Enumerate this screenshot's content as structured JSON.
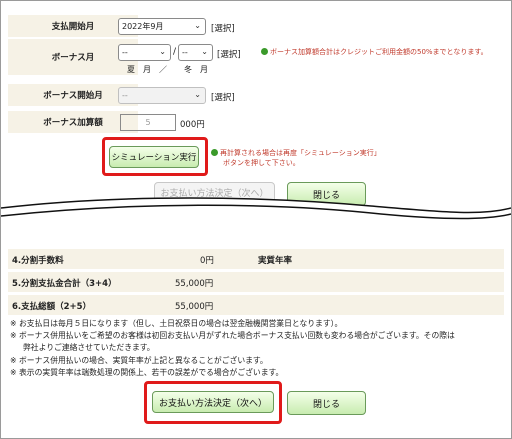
{
  "form": {
    "pay_start": {
      "label": "支払開始月",
      "value": "2022年9月",
      "action": "[選択]"
    },
    "bonus_month": {
      "label": "ボーナス月",
      "summer": "--",
      "winter": "--",
      "action": "[選択]",
      "summer_label": "夏　月",
      "slash": "／",
      "winter_label": "冬　月",
      "note": "ボーナス加算額合計はクレジットご利用金額の50%までとなります。"
    },
    "bonus_start": {
      "label": "ボーナス開始月",
      "value": "--",
      "action": "[選択]"
    },
    "bonus_amount": {
      "label": "ボーナス加算額",
      "value": "5",
      "unit": "000円"
    }
  },
  "simulate_button": "シミュレーション実行",
  "recalc_note": {
    "line1": "再計算される場合は再度「シミュレーション実行」",
    "line2": "ボタンを押して下さい。"
  },
  "top_buttons": {
    "decide": "お支払い方法決定（次へ）",
    "close": "閉じる"
  },
  "results": [
    {
      "label": "4.分割手数料",
      "value": "0円",
      "extra_label": "実質年率",
      "extra_value": ""
    },
    {
      "label": "5.分割支払金合計（3+4）",
      "value": "55,000円"
    },
    {
      "label": "6.支払総額（2+5）",
      "value": "55,000円"
    }
  ],
  "notes": [
    "※ お支払日は毎月５日になります（但し、土日祝祭日の場合は翌金融機関営業日となります）。",
    "※ ボーナス併用払いをご希望のお客様は初回お支払い月がずれた場合ボーナス支払い回数も変わる場合がございます。その際は",
    "弊社よりご連絡させていただきます。",
    "※ ボーナス併用払いの場合、実質年率が上記と異なることがございます。",
    "※ 表示の実質年率は端数処理の関係上、若干の誤差がでる場合がございます。"
  ],
  "bottom_buttons": {
    "decide": "お支払い方法決定（次へ）",
    "close": "閉じる"
  },
  "colors": {
    "label_bg": "#f6f2e6",
    "highlight": "#e01a1a",
    "button_green": "#c8ecb0",
    "note_red": "#c0392b"
  }
}
